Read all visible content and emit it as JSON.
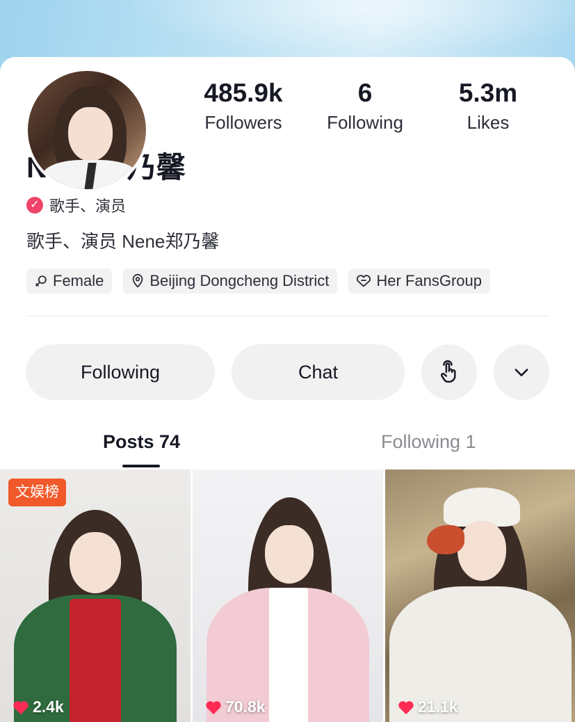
{
  "profile": {
    "name": "Nene郑乃馨",
    "verified_label": "歌手、演员",
    "bio": "歌手、演员 Nene郑乃馨"
  },
  "stats": [
    {
      "value": "485.9k",
      "label": "Followers"
    },
    {
      "value": "6",
      "label": "Following"
    },
    {
      "value": "5.3m",
      "label": "Likes"
    }
  ],
  "tags": [
    {
      "icon": "female-icon",
      "label": "Female"
    },
    {
      "icon": "location-pin-icon",
      "label": "Beijing Dongcheng District"
    },
    {
      "icon": "heart-outline-icon",
      "label": "Her FansGroup"
    }
  ],
  "actions": {
    "following_label": "Following",
    "chat_label": "Chat",
    "touch_icon": "tap-hand-icon",
    "more_icon": "chevron-down-icon"
  },
  "tabs": [
    {
      "label": "Posts 74",
      "active": true
    },
    {
      "label": "Following 1",
      "active": false
    }
  ],
  "posts": [
    {
      "badge": "文娱榜",
      "likes": "2.4k"
    },
    {
      "badge": "",
      "likes": "70.8k"
    },
    {
      "badge": "",
      "likes": "21.1k"
    }
  ],
  "colors": {
    "verify_badge": "#f0446a",
    "rank_badge": "#f1592a",
    "like_heart": "#fe2c55"
  }
}
